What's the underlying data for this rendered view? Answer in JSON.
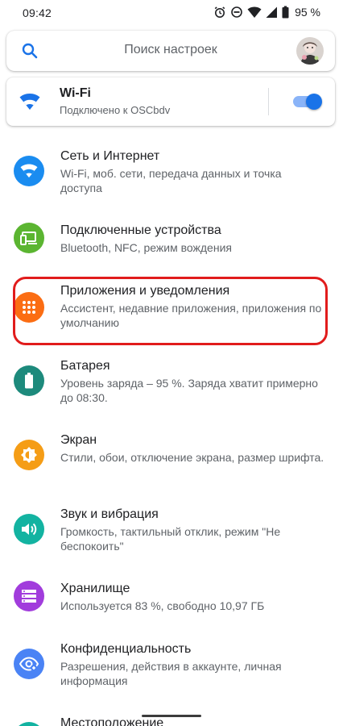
{
  "status_bar": {
    "time": "09:42",
    "battery_percent": "95 %",
    "icons": [
      "alarm-icon",
      "dnd-icon",
      "wifi-signal-icon",
      "cellular-signal-icon",
      "battery-icon"
    ]
  },
  "search": {
    "placeholder": "Поиск настроек",
    "icon": "search-icon"
  },
  "wifi": {
    "title": "Wi-Fi",
    "subtitle": "Подключено к OSCbdv",
    "enabled": true,
    "colors": {
      "icon": "#1a73e8",
      "toggle_thumb": "#1a73e8",
      "toggle_track": "#8ab4f8"
    }
  },
  "settings": [
    {
      "title": "Сеть и Интернет",
      "subtitle": "Wi-Fi, моб. сети, передача данных и точка доступа",
      "icon": "wifi-icon",
      "color": "#1a8cf0"
    },
    {
      "title": "Подключенные устройства",
      "subtitle": "Bluetooth, NFC, режим вождения",
      "icon": "devices-icon",
      "color": "#5bb531"
    },
    {
      "title": "Приложения и уведомления",
      "subtitle": "Ассистент, недавние приложения, приложения по умолчанию",
      "icon": "apps-grid-icon",
      "color": "#fb6d13"
    },
    {
      "title": "Батарея",
      "subtitle": "Уровень заряда – 95 %. Заряда хватит примерно до 08:30.",
      "icon": "battery-icon",
      "color": "#1d8a7c"
    },
    {
      "title": "Экран",
      "subtitle": "Стили, обои, отключение экрана, размер шрифта.",
      "icon": "brightness-icon",
      "color": "#f59d16"
    },
    {
      "title": "Звук и вибрация",
      "subtitle": "Громкость, тактильный отклик, режим \"Не беспокоить\"",
      "icon": "volume-icon",
      "color": "#13b3a1"
    },
    {
      "title": "Хранилище",
      "subtitle": "Используется 83 %, свободно 10,97 ГБ",
      "icon": "storage-icon",
      "color": "#a13cdc"
    },
    {
      "title": "Конфиденциальность",
      "subtitle": "Разрешения, действия в аккаунте, личная информация",
      "icon": "privacy-eye-icon",
      "color": "#4a83f5"
    },
    {
      "title": "Местоположение",
      "subtitle": "",
      "icon": "location-icon",
      "color": "#13b3a1"
    }
  ],
  "highlight": {
    "target": "Приложения и уведомления",
    "color": "#e11c1c"
  }
}
